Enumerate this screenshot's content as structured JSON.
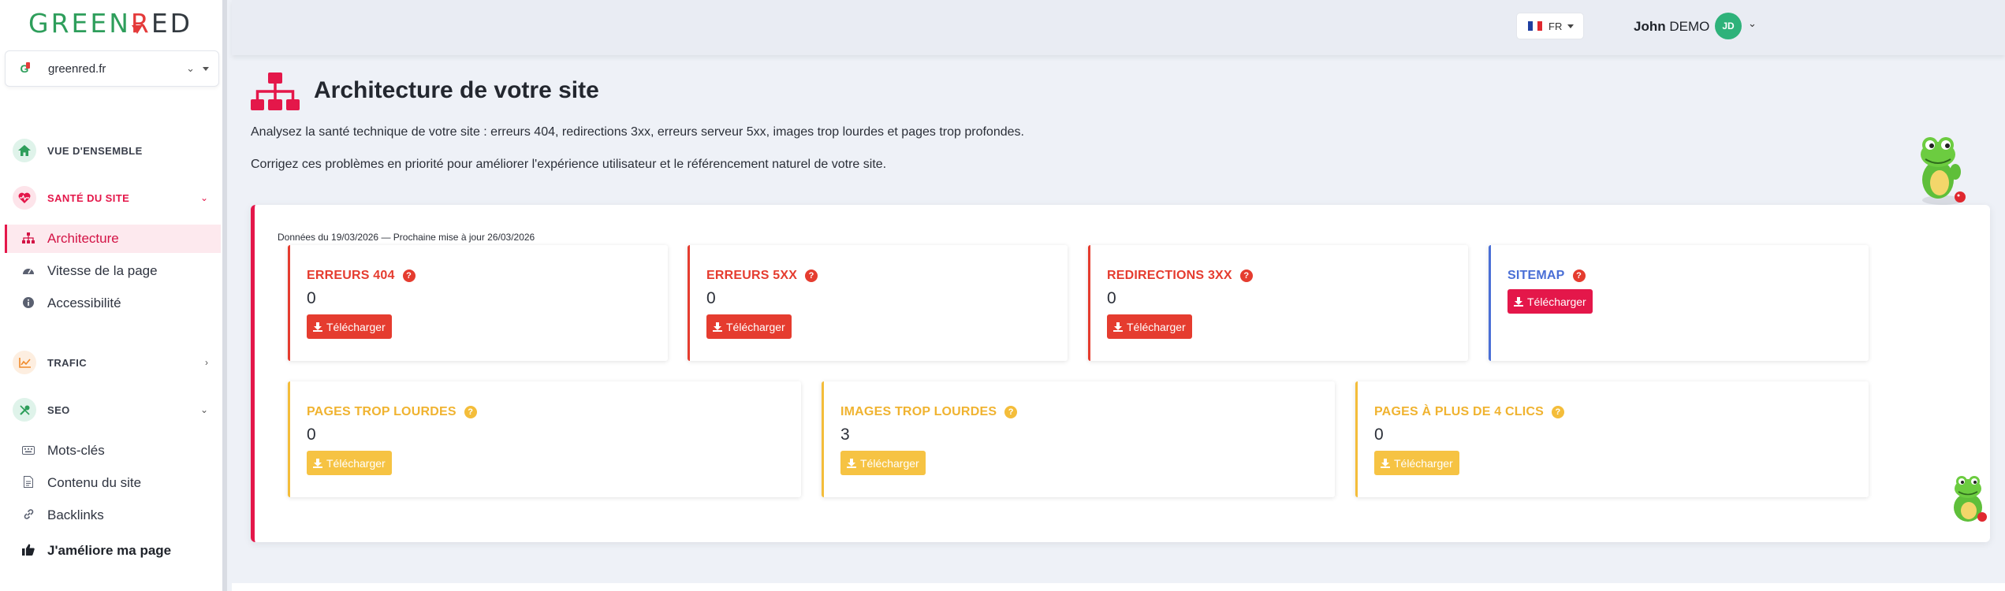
{
  "brand": {
    "logo_pre": "GREEN",
    "logo_mid": "R",
    "logo_post": "ED",
    "colors": {
      "green": "#2e9e5b",
      "red": "#e43a3a",
      "accent": "#e4174a"
    }
  },
  "site_selector": {
    "value": "greenred.fr"
  },
  "sidebar": {
    "sections": [
      {
        "label": "VUE D'ENSEMBLE",
        "icon": "home-icon"
      },
      {
        "label": "SANTÉ DU SITE",
        "icon": "heartbeat-icon"
      },
      {
        "label": "TRAFIC",
        "icon": "chart-line-icon"
      },
      {
        "label": "SEO",
        "icon": "tools-icon"
      }
    ],
    "items": [
      {
        "label": "Architecture",
        "icon": "sitemap-icon",
        "active": true
      },
      {
        "label": "Vitesse de la page",
        "icon": "gauge-icon"
      },
      {
        "label": "Accessibilité",
        "icon": "info-icon"
      },
      {
        "label": "Mots-clés",
        "icon": "keyboard-icon"
      },
      {
        "label": "Contenu du site",
        "icon": "file-icon"
      },
      {
        "label": "Backlinks",
        "icon": "link-icon"
      },
      {
        "label": "J'améliore ma page",
        "icon": "thumbs-up-icon"
      }
    ]
  },
  "topbar": {
    "language": "FR",
    "user_first": "John",
    "user_last": "DEMO",
    "avatar_initials": "JD"
  },
  "page": {
    "title": "Architecture de votre site",
    "description1": "Analysez la santé technique de votre site : erreurs 404, redirections 3xx, erreurs serveur 5xx, images trop lourdes et pages trop profondes.",
    "description2": "Corrigez ces problèmes en priorité pour améliorer l'expérience utilisateur et le référencement naturel de votre site.",
    "data_note": "Données du 19/03/2026 — Prochaine mise à jour 26/03/2026"
  },
  "cards": [
    {
      "title": "ERREURS 404",
      "value": "0",
      "button": "Télécharger"
    },
    {
      "title": "ERREURS 5XX",
      "value": "0",
      "button": "Télécharger"
    },
    {
      "title": "REDIRECTIONS 3XX",
      "value": "0",
      "button": "Télécharger"
    },
    {
      "title": "SITEMAP",
      "button": "Télécharger"
    },
    {
      "title": "PAGES TROP LOURDES",
      "value": "0",
      "button": "Télécharger"
    },
    {
      "title": "IMAGES TROP LOURDES",
      "value": "3",
      "button": "Télécharger"
    },
    {
      "title": "PAGES À PLUS DE 4 CLICS",
      "value": "0",
      "button": "Télécharger"
    }
  ]
}
